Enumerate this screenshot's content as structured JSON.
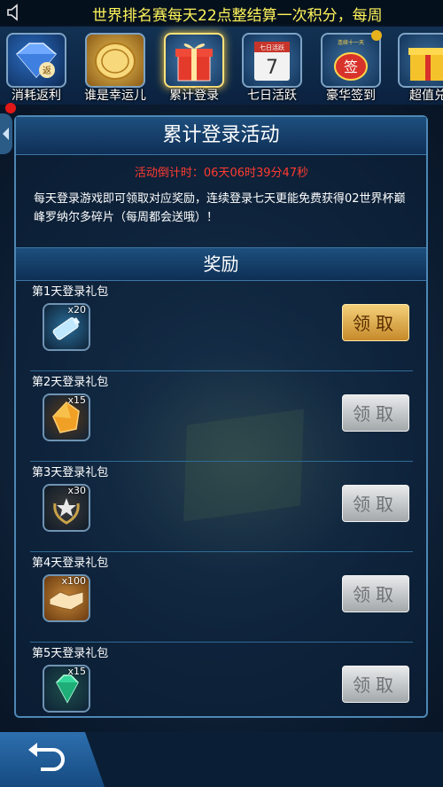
{
  "marquee": "世界排名赛每天22点整结算一次积分，每周",
  "tabs": [
    {
      "label": "消耗返利",
      "icon": "diamond-icon",
      "corner": "返"
    },
    {
      "label": "谁是幸运儿",
      "icon": "coin-icon"
    },
    {
      "label": "累计登录",
      "icon": "gift-box-icon",
      "active": true
    },
    {
      "label": "七日活跃",
      "icon": "calendar-7-icon",
      "corner": "七日活跃",
      "number": "7"
    },
    {
      "label": "豪华签到",
      "icon": "sign-in-icon",
      "corner": "签",
      "top": "连续十一天"
    },
    {
      "label": "超值兑",
      "icon": "gift-box-yellow-icon"
    }
  ],
  "panel": {
    "title": "累计登录活动",
    "countdown": "活动倒计时：06天06时39分47秒",
    "description": "每天登录游戏即可领取对应奖励，连续登录七天更能免费获得02世界杯巅峰罗纳尔多碎片（每周都会送哦）！",
    "reward_header": "奖励"
  },
  "rewards": [
    {
      "day": "第1天登录礼包",
      "item_icon": "energy-drink-icon",
      "qty": "x20",
      "button": "领取",
      "state": "available"
    },
    {
      "day": "第2天登录礼包",
      "item_icon": "orange-gem-icon",
      "qty": "x15",
      "button": "领取",
      "state": "disabled"
    },
    {
      "day": "第3天登录礼包",
      "item_icon": "star-laurel-icon",
      "qty": "x30",
      "button": "领取",
      "state": "disabled"
    },
    {
      "day": "第4天登录礼包",
      "item_icon": "handshake-icon",
      "qty": "x100",
      "button": "领取",
      "state": "disabled"
    },
    {
      "day": "第5天登录礼包",
      "item_icon": "green-gem-icon",
      "qty": "x15",
      "button": "领取",
      "state": "disabled"
    }
  ],
  "colors": {
    "countdown": "#ff3b2f",
    "marquee": "#fff45a",
    "button_gold": "#e0a845",
    "button_gray": "#c9cccd"
  }
}
